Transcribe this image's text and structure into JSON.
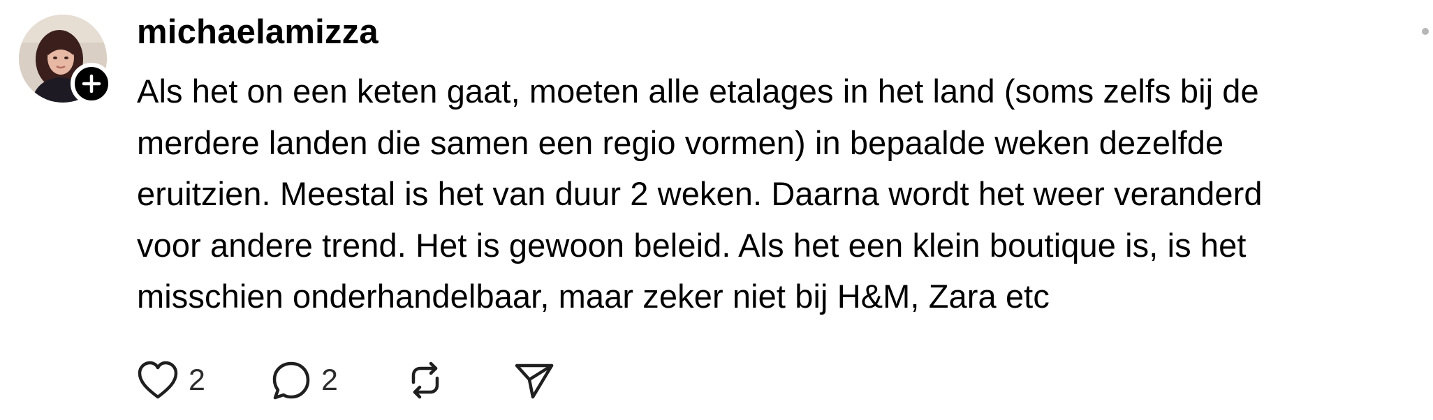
{
  "post": {
    "username": "michaelamizza",
    "text_lines": [
      "Als het on een keten gaat, moeten alle etalages in het land (soms zelfs bij de",
      "merdere landen die samen een regio vormen) in bepaalde weken dezelfde",
      "eruitzien. Meestal is het van duur 2 weken. Daarna wordt het weer veranderd",
      "voor andere trend. Het is gewoon beleid. Als het een klein boutique is, is het",
      "misschien onderhandelbaar, maar zeker niet bij H&M, Zara etc"
    ],
    "avatar_icon": "user-avatar",
    "follow_icon": "plus-icon",
    "more_icon": "more-dot-icon"
  },
  "actions": {
    "like": {
      "icon": "heart-icon",
      "count": "2"
    },
    "reply": {
      "icon": "comment-bubble-icon",
      "count": "2"
    },
    "repost": {
      "icon": "repost-icon"
    },
    "share": {
      "icon": "send-icon"
    }
  },
  "colors": {
    "text": "#000000",
    "count_text": "#2d2d2d",
    "background": "#ffffff",
    "badge": "#000000",
    "more_dot": "#b7b7b7"
  }
}
